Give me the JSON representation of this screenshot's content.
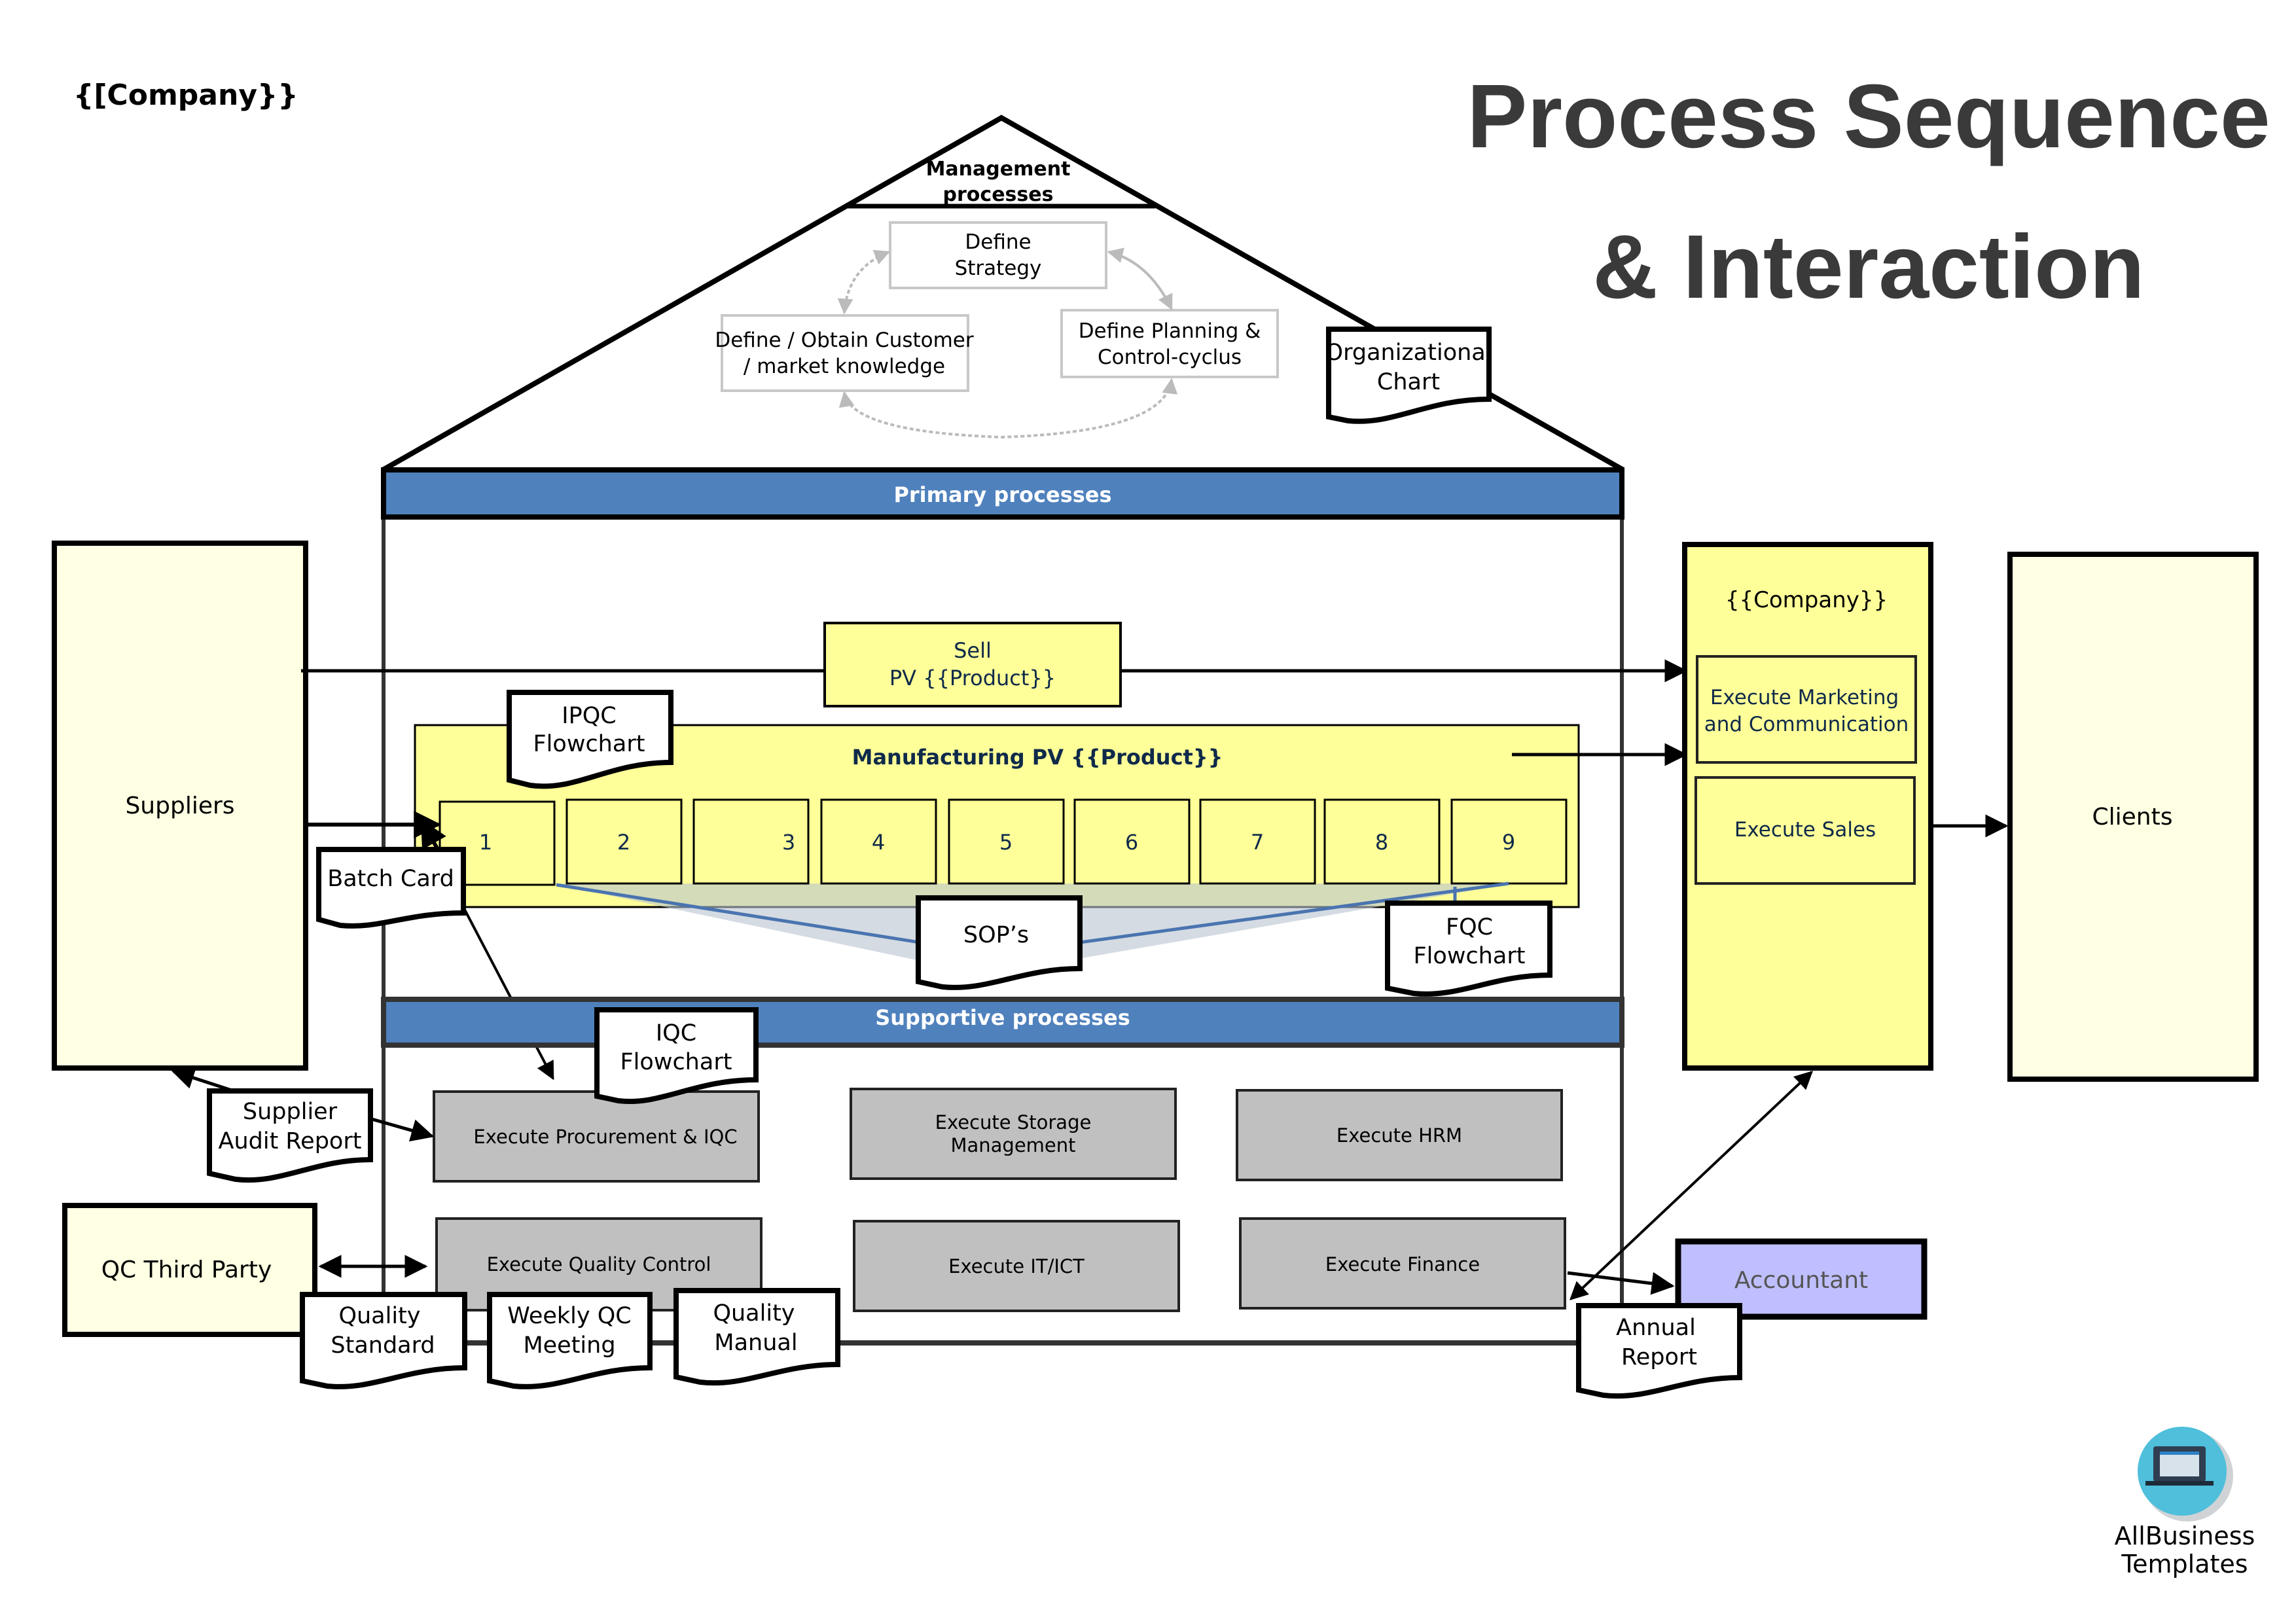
{
  "header": {
    "company_tag": "{[Company}}",
    "title_line1": "Process Sequence",
    "title_line2": "& Interaction"
  },
  "management": {
    "label_line1": "Management",
    "label_line2": "processes",
    "strategy": [
      "Define",
      "Strategy"
    ],
    "customer": [
      "Define / Obtain Customer",
      "/ market knowledge"
    ],
    "planning": [
      "Define Planning &",
      "Control-cyclus"
    ],
    "org_chart": [
      "Organizational",
      "Chart"
    ]
  },
  "primary": {
    "bar_label": "Primary processes",
    "sell": [
      "Sell",
      "PV {{Product}}"
    ],
    "manufacturing_label": "Manufacturing PV {{Product}}",
    "steps": [
      "1",
      "2",
      "3",
      "4",
      "5",
      "6",
      "7",
      "8",
      "9"
    ],
    "ipqc": [
      "IPQC",
      "Flowchart"
    ],
    "batch_card": "Batch Card",
    "sops": "SOP’s",
    "fqc": [
      "FQC",
      "Flowchart"
    ]
  },
  "supportive": {
    "bar_label": "Supportive processes",
    "iqc": [
      "IQC",
      "Flowchart"
    ],
    "boxes": {
      "procurement": "Execute Procurement & IQC",
      "storage": [
        "Execute Storage",
        "Management"
      ],
      "hrm": "Execute HRM",
      "quality_control": "Execute Quality Control",
      "it": "Execute IT/ICT",
      "finance": "Execute Finance"
    },
    "docs": {
      "quality_standard": [
        "Quality",
        "Standard"
      ],
      "weekly_qc": [
        "Weekly QC",
        "Meeting"
      ],
      "quality_manual": [
        "Quality",
        "Manual"
      ],
      "annual_report": [
        "Annual",
        "Report"
      ],
      "supplier_audit": [
        "Supplier",
        "Audit Report"
      ]
    }
  },
  "external": {
    "suppliers": "Suppliers",
    "qc_third_party": "QC Third Party",
    "clients": "Clients",
    "accountant": "Accountant",
    "company_box": {
      "label": "{{Company}}",
      "marketing": [
        "Execute Marketing",
        "and Communication"
      ],
      "sales": "Execute Sales"
    }
  },
  "logo": {
    "icon": "laptop-icon",
    "line1": "AllBusiness",
    "line2": "Templates"
  },
  "colors": {
    "blue_bar": "#4f81bd",
    "yellow": "#ffff99",
    "pale_yellow": "#ffffe3",
    "grey_box": "#c0c0c0",
    "accountant": "#bfbfff",
    "title": "#3a3a3a",
    "logo_circle": "#4fbfdb"
  }
}
